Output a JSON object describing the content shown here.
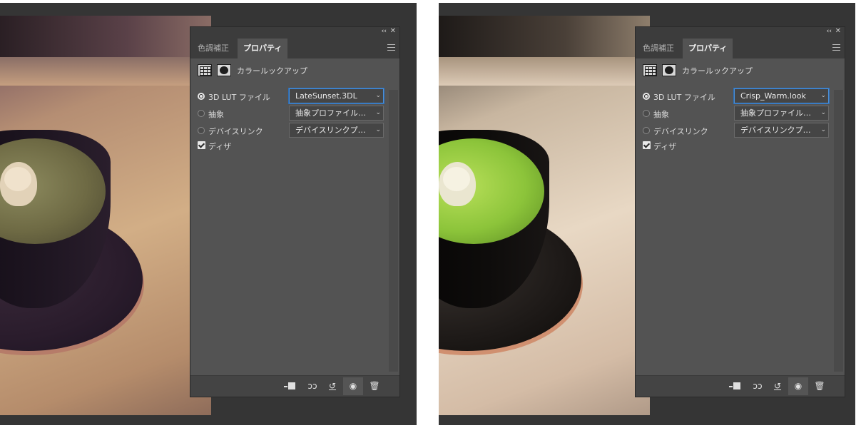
{
  "icons": [
    "collapse-icon",
    "close-icon",
    "menu-icon",
    "lut-grid-icon",
    "mask-icon",
    "chevron-down-icon",
    "clip-to-layer-icon",
    "view-previous-icon",
    "reset-icon",
    "eye-icon",
    "trash-icon"
  ],
  "left": {
    "panel": {
      "collapse_glyph": "‹‹",
      "close_glyph": "✕",
      "tabs": [
        "色調補正",
        "プロパティ"
      ],
      "active_tab": "プロパティ",
      "header_title": "カラールックアップ",
      "options": [
        {
          "type": "radio",
          "label": "3D LUT ファイル",
          "checked": true,
          "dropdown": "LateSunset.3DL",
          "focused": true
        },
        {
          "type": "radio",
          "label": "抽象",
          "checked": false,
          "dropdown": "抽象プロファイルを..."
        },
        {
          "type": "radio",
          "label": "デバイスリンク",
          "checked": false,
          "dropdown": "デバイスリンクプロファ..."
        }
      ],
      "dither": {
        "label": "ディザ",
        "checked": true
      },
      "chevron_glyph": "⌄",
      "bottom": {
        "view_prev": "👁̸",
        "reset": "↺",
        "eye": "👁",
        "trash": "🗑"
      }
    }
  },
  "right": {
    "panel": {
      "collapse_glyph": "‹‹",
      "close_glyph": "✕",
      "tabs": [
        "色調補正",
        "プロパティ"
      ],
      "active_tab": "プロパティ",
      "header_title": "カラールックアップ",
      "options": [
        {
          "type": "radio",
          "label": "3D LUT ファイル",
          "checked": true,
          "dropdown": "Crisp_Warm.look",
          "focused": true
        },
        {
          "type": "radio",
          "label": "抽象",
          "checked": false,
          "dropdown": "抽象プロファイルを..."
        },
        {
          "type": "radio",
          "label": "デバイスリンク",
          "checked": false,
          "dropdown": "デバイスリンクプロファ..."
        }
      ],
      "dither": {
        "label": "ディザ",
        "checked": true
      },
      "chevron_glyph": "⌄",
      "bottom": {
        "view_prev": "👁̸",
        "reset": "↺",
        "eye": "👁",
        "trash": "🗑"
      }
    }
  }
}
